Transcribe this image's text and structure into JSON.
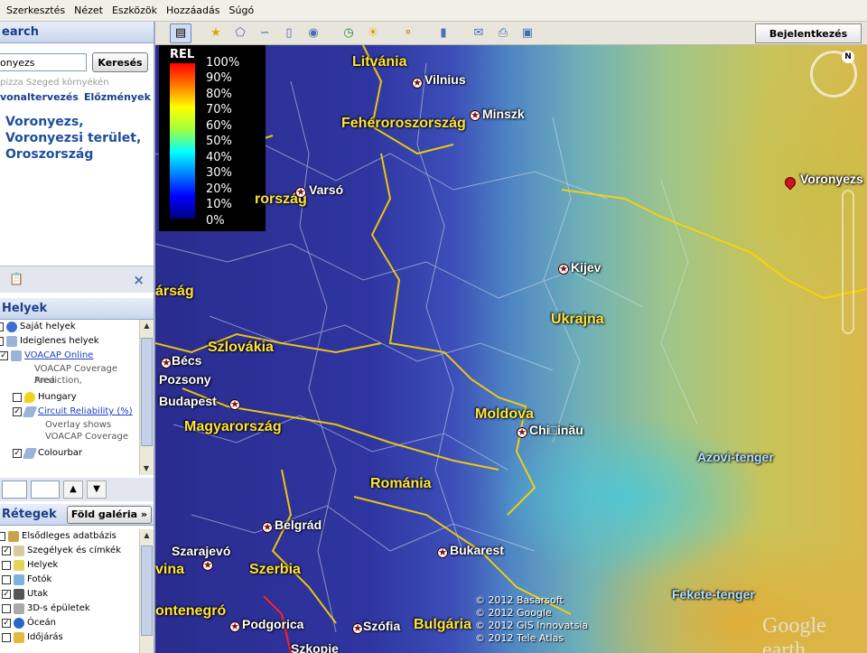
{
  "menu": [
    "Szerkesztés",
    "Nézet",
    "Eszközök",
    "Hozzáadás",
    "Súgó"
  ],
  "search": {
    "header": "earch",
    "query": "onyezs",
    "button": "Keresés",
    "hint": "pizza Szeged környékén",
    "link_route": "vonaltervezés",
    "link_history": "Előzmények",
    "result": "Voronyezs, Voronyezsi terület, Oroszország"
  },
  "places": {
    "header": "Helyek",
    "items": [
      {
        "label": "Saját helyek",
        "checked": false,
        "icon": "globe-icon"
      },
      {
        "label": "Ideiglenes helyek",
        "checked": false,
        "icon": "folder-icon"
      },
      {
        "label": "VOACAP Online",
        "checked": true,
        "icon": "folder-icon",
        "link": true,
        "desc": [
          "VOACAP Coverage Area",
          "Prediction,"
        ]
      },
      {
        "label": "Hungary",
        "checked": false,
        "icon": "pin-icon"
      },
      {
        "label": "Circuit Reliability (%)",
        "checked": true,
        "icon": "overlay-icon",
        "link": true,
        "desc": [
          "Overlay shows",
          "VOACAP Coverage"
        ]
      },
      {
        "label": "Colourbar",
        "checked": true,
        "icon": "overlay-icon"
      }
    ]
  },
  "layers": {
    "header": "Rétegek",
    "gallery_button": "Föld galéria »",
    "items": [
      {
        "label": "Elsődleges adatbázis",
        "checked": false
      },
      {
        "label": "Szegélyek és címkék",
        "checked": true
      },
      {
        "label": "Helyek",
        "checked": false
      },
      {
        "label": "Fotók",
        "checked": false
      },
      {
        "label": "Utak",
        "checked": true
      },
      {
        "label": "3D-s épületek",
        "checked": false
      },
      {
        "label": "Óceán",
        "checked": true
      },
      {
        "label": "Időjárás",
        "checked": false
      }
    ]
  },
  "toolbar": {
    "login": "Bejelentkezés"
  },
  "legend": {
    "title": "REL",
    "labels": [
      "100%",
      "90%",
      "80%",
      "70%",
      "60%",
      "50%",
      "40%",
      "30%",
      "20%",
      "10%",
      "0%"
    ]
  },
  "map": {
    "countries": [
      "Litvánia",
      "Fehéroroszország",
      "rország",
      "Ukrajna",
      "Szlovákia",
      "Magyarország",
      "Moldova",
      "Románia",
      "Szerbia",
      "Bulgária",
      "ontenegró",
      "árság",
      "vina"
    ],
    "cities": [
      "Vilnius",
      "Minszk",
      "Varsó",
      "Kijev",
      "Bécs",
      "Pozsony",
      "Budapest",
      "Chi□inău",
      "Belgrád",
      "Szarajevó",
      "Bukarest",
      "Podgorica",
      "Szófia",
      "Szkopje",
      "Voronyezs"
    ],
    "seas": [
      "Azovi-tenger",
      "Fekete-tenger"
    ],
    "attribution": [
      "© 2012 Basarsoft",
      "© 2012 Google",
      "© 2012 GIS Innovatsia",
      "© 2012 Tele Atlas"
    ],
    "logo": "Google earth",
    "compass_north": "N"
  }
}
